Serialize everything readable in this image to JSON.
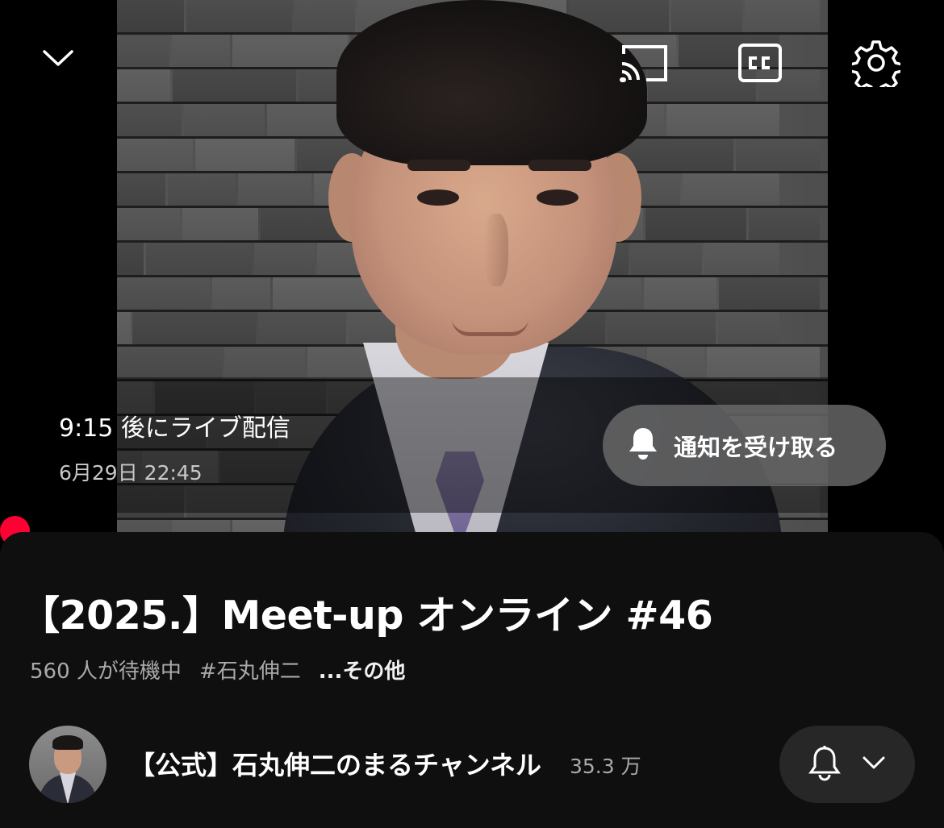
{
  "player": {
    "live_countdown": "9:15 後にライブ配信",
    "scheduled_date": "6月29日 22:45",
    "notify_button_label": "通知を受け取る",
    "controls": {
      "collapse_icon": "chevron-down-icon",
      "cast_icon": "cast-icon",
      "captions_icon": "closed-captions-icon",
      "settings_icon": "gear-icon"
    },
    "accent_color": "#ff0033"
  },
  "video": {
    "title": "【2025.】Meet-up オンライン #46",
    "waiting_count": "560 人が待機中",
    "hashtag": "#石丸伸二",
    "more_label": "...その他"
  },
  "channel": {
    "name": "【公式】石丸伸二のまるチャンネル",
    "subscribers": "35.3 万",
    "subscribe_button_icons": [
      "bell-icon",
      "chevron-down-icon"
    ]
  }
}
